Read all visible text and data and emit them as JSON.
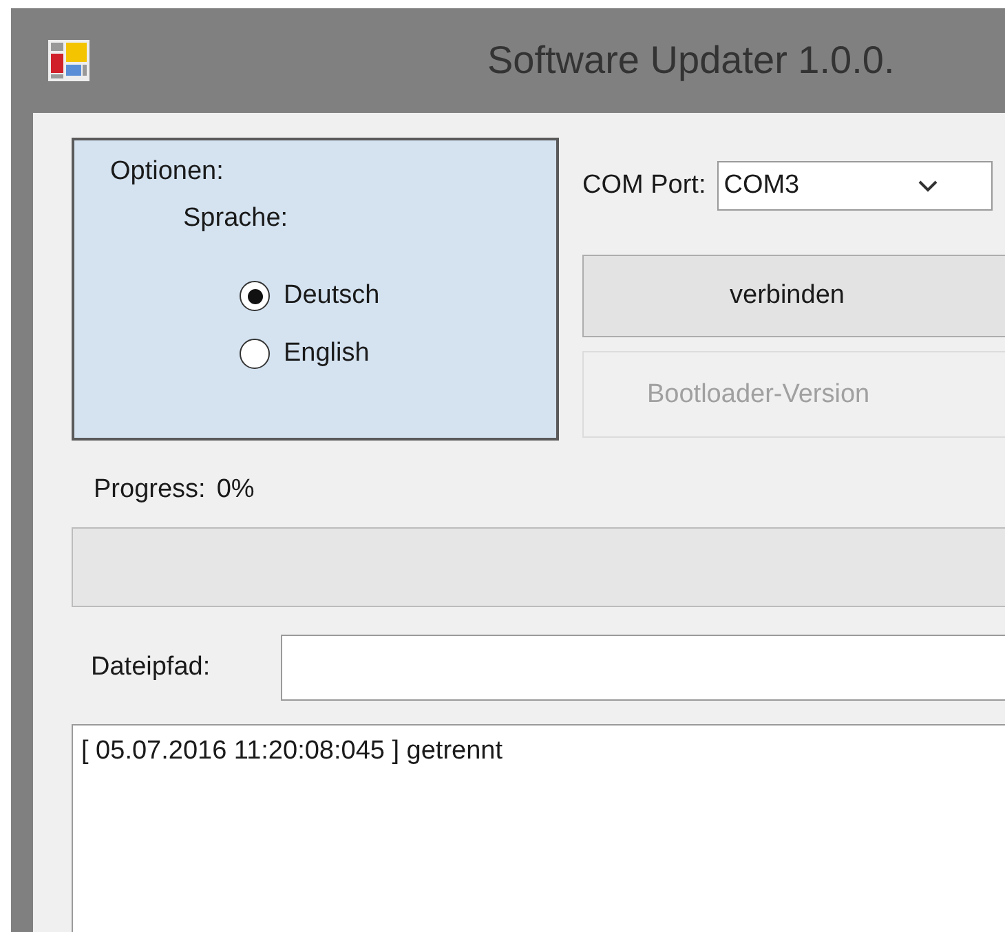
{
  "window": {
    "title": "Software Updater 1.0.0."
  },
  "options": {
    "title": "Optionen:",
    "language_label": "Sprache:",
    "languages": [
      {
        "label": "Deutsch",
        "selected": true
      },
      {
        "label": "English",
        "selected": false
      }
    ]
  },
  "com_port": {
    "label": "COM Port:",
    "value": "COM3"
  },
  "buttons": [
    {
      "label": "verbinden",
      "disabled": false
    },
    {
      "label": "Bootloader-Version",
      "disabled": true
    }
  ],
  "progress": {
    "label": "Progress:",
    "reading": "0%",
    "level": 0
  },
  "file_path": {
    "label": "Dateipfad:"
  },
  "log": [
    "[ 05.07.2016 11:20:08:045 ] getrennt"
  ]
}
